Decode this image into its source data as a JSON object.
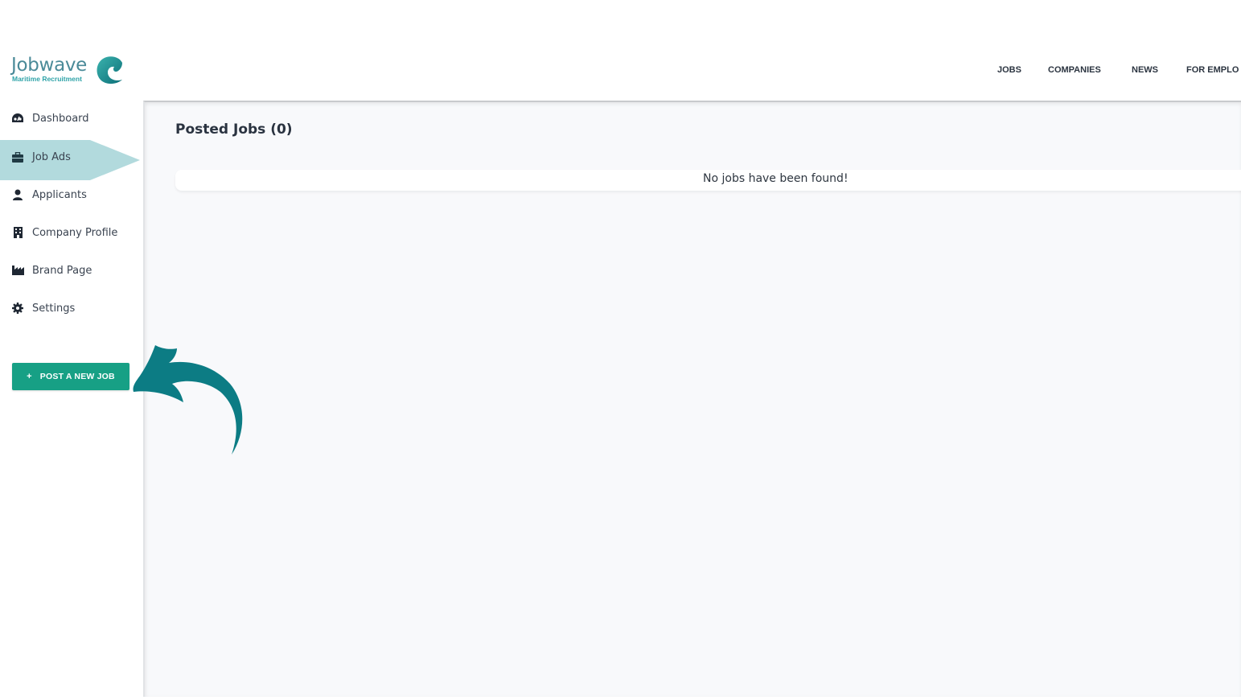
{
  "brand": {
    "name": "Jobwave",
    "tagline": "Maritime Recruitment",
    "colors": {
      "primary": "#0f7d87",
      "accent": "#17a085",
      "active_bg": "#b2dadd"
    }
  },
  "topnav": {
    "items": [
      {
        "label": "JOBS"
      },
      {
        "label": "COMPANIES"
      },
      {
        "label": "NEWS"
      },
      {
        "label": "FOR EMPLO"
      }
    ]
  },
  "sidebar": {
    "items": [
      {
        "label": "Dashboard",
        "icon": "dashboard-gauge-icon",
        "active": false
      },
      {
        "label": "Job Ads",
        "icon": "briefcase-icon",
        "active": true
      },
      {
        "label": "Applicants",
        "icon": "user-icon",
        "active": false
      },
      {
        "label": "Company Profile",
        "icon": "building-icon",
        "active": false
      },
      {
        "label": "Brand Page",
        "icon": "industry-icon",
        "active": false
      },
      {
        "label": "Settings",
        "icon": "gear-icon",
        "active": false
      }
    ],
    "post_button": {
      "icon": "+",
      "label": "POST A NEW JOB"
    }
  },
  "main": {
    "title": "Posted Jobs (0)",
    "empty_message": "No jobs have been found!"
  },
  "annotation": {
    "icon": "curved-arrow-icon",
    "color": "#0c7c84"
  }
}
